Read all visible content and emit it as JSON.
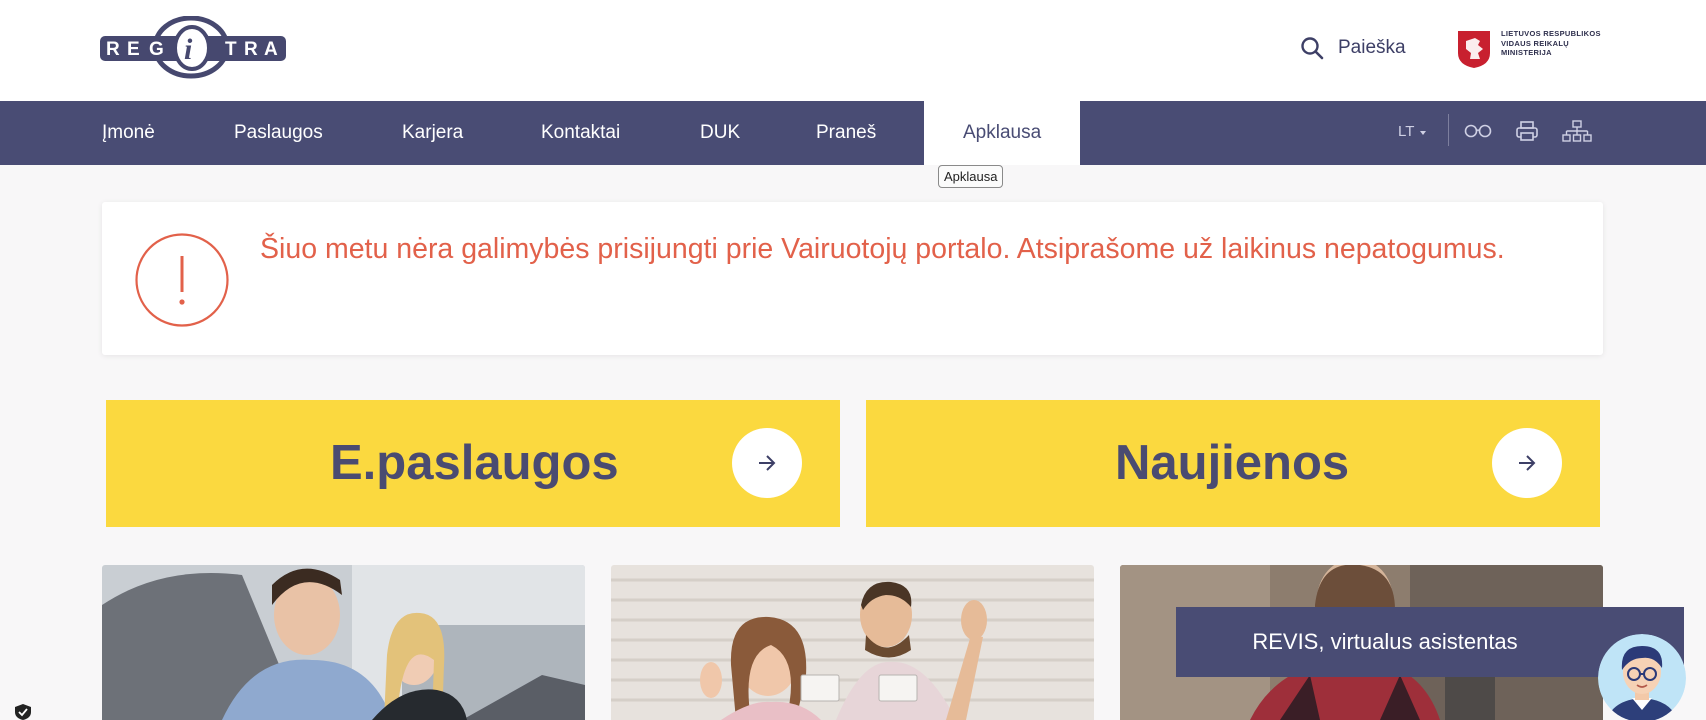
{
  "header": {
    "logo_text": [
      "R",
      "E",
      "G",
      "i",
      "T",
      "R",
      "A"
    ],
    "search_label": "Paieška",
    "ministry_text": "LIETUVOS RESPUBLIKOS\nVIDAUS REIKALŲ\nMINISTERIJA"
  },
  "nav": {
    "items": [
      {
        "label": "Įmonė"
      },
      {
        "label": "Paslaugos"
      },
      {
        "label": "Karjera"
      },
      {
        "label": "Kontaktai"
      },
      {
        "label": "DUK"
      },
      {
        "label": "Praneš"
      },
      {
        "label": "Apklausa",
        "active": true
      }
    ],
    "language": "LT",
    "tooltip": "Apklausa"
  },
  "alert": {
    "text": "Šiuo metu nėra galimybės prisijungti prie Vairuotojų portalo. Atsiprašome už laikinus nepatogumus.",
    "color": "#e2614a"
  },
  "cta": {
    "left_title": "E.paslaugos",
    "right_title": "Naujienos",
    "background": "#fbd93f"
  },
  "assistant": {
    "label": "REVIS, virtualus asistentas"
  },
  "colors": {
    "nav_bg": "#494c74",
    "brand": "#46486f",
    "accent_yellow": "#fbd93f"
  }
}
